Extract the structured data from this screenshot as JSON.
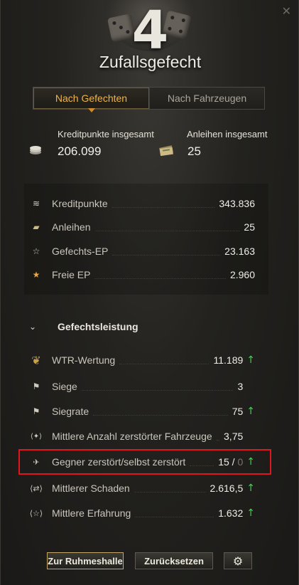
{
  "window": {
    "close_icon": "close-icon",
    "battle_type_number": "4",
    "title": "Zufallsgefecht"
  },
  "tabs": [
    {
      "label": "Nach Gefechten",
      "active": true
    },
    {
      "label": "Nach Fahrzeugen",
      "active": false
    }
  ],
  "totals": {
    "credits_label": "Kreditpunkte insgesamt",
    "credits_value": "206.099",
    "bonds_label": "Anleihen insgesamt",
    "bonds_value": "25"
  },
  "earnings": [
    {
      "icon": "credits-icon",
      "label": "Kreditpunkte",
      "value": "343.836"
    },
    {
      "icon": "bonds-icon",
      "label": "Anleihen",
      "value": "25"
    },
    {
      "icon": "battle-xp-icon",
      "label": "Gefechts-EP",
      "value": "23.163"
    },
    {
      "icon": "free-xp-icon",
      "label": "Freie EP",
      "value": "2.960"
    }
  ],
  "performance": {
    "title": "Gefechtsleistung",
    "rows": [
      {
        "icon": "wtr-medal-icon",
        "label": "WTR-Wertung",
        "value": "11.189",
        "trend": "up"
      },
      {
        "icon": "flag-icon",
        "label": "Siege",
        "value": "3",
        "trend": ""
      },
      {
        "icon": "flag-icon",
        "label": "Siegrate",
        "value": "75",
        "trend": "up"
      },
      {
        "icon": "destroyed-vehicles-icon",
        "label": "Mittlere Anzahl zerstörter Fahrzeuge",
        "value": "3,75",
        "trend": ""
      },
      {
        "icon": "kill-death-icon",
        "label": "Gegner zerstört/selbst zerstört",
        "value": "15",
        "value_secondary": "0",
        "trend": "up"
      },
      {
        "icon": "damage-icon",
        "label": "Mittlerer Schaden",
        "value": "2.616,5",
        "trend": "up"
      },
      {
        "icon": "experience-icon",
        "label": "Mittlere Erfahrung",
        "value": "1.632",
        "trend": "up"
      }
    ]
  },
  "buttons": {
    "hall_of_fame": "Zur Ruhmeshalle",
    "reset": "Zurücksetzen",
    "settings_icon": "gear-icon"
  },
  "colors": {
    "accent_tab": "#f0b34a",
    "trend_up": "#3bd84b",
    "highlight_border": "#e0161e"
  }
}
